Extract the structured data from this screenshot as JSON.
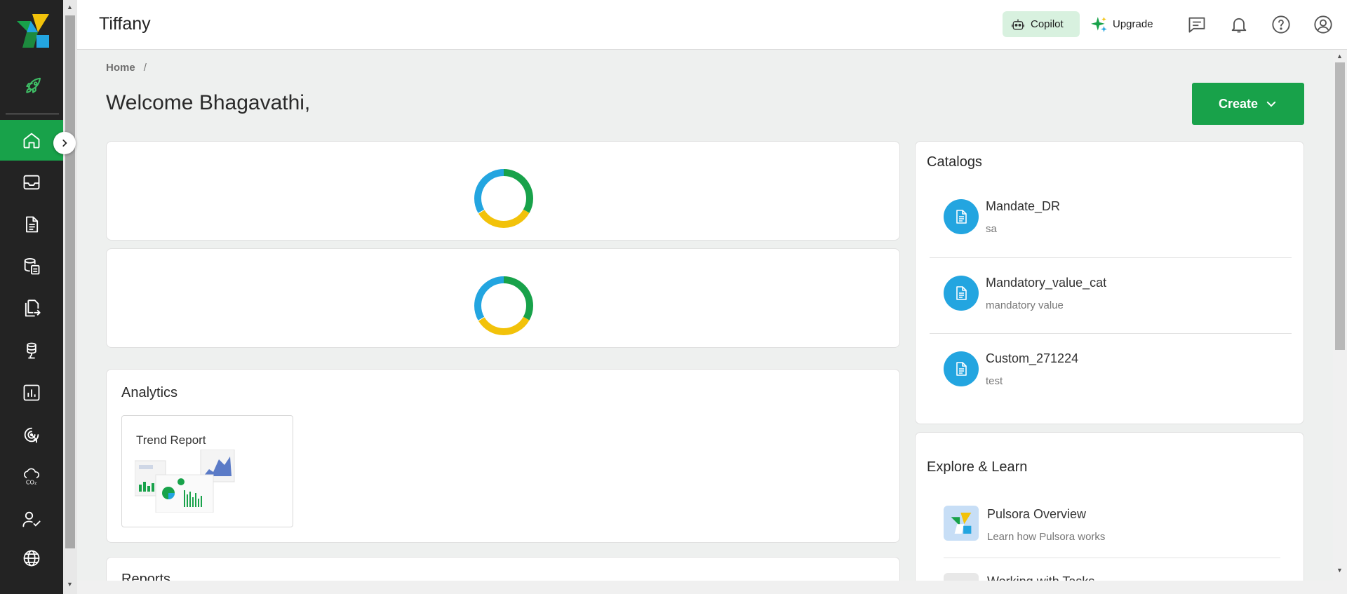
{
  "app": {
    "title": "Tiffany"
  },
  "header": {
    "copilot_label": "Copilot",
    "upgrade_label": "Upgrade",
    "icons": [
      "chat-icon",
      "bell-icon",
      "help-icon",
      "user-account-icon"
    ]
  },
  "sidebar": {
    "items": [
      {
        "icon": "home-icon",
        "active": true
      },
      {
        "icon": "inbox-icon",
        "active": false
      },
      {
        "icon": "document-icon",
        "active": false
      },
      {
        "icon": "data-copy-icon",
        "active": false
      },
      {
        "icon": "export-document-icon",
        "active": false
      },
      {
        "icon": "database-icon",
        "active": false
      },
      {
        "icon": "bar-chart-icon",
        "active": false
      },
      {
        "icon": "target-icon",
        "active": false
      },
      {
        "icon": "co2-cloud-icon",
        "active": false
      },
      {
        "icon": "user-check-icon",
        "active": false
      },
      {
        "icon": "globe-icon",
        "active": false
      }
    ]
  },
  "breadcrumb": {
    "home": "Home",
    "separator": "/"
  },
  "welcome": "Welcome Bhagavathi,",
  "create_button": "Create",
  "analytics": {
    "title": "Analytics",
    "cards": [
      {
        "label": "Trend Report"
      }
    ]
  },
  "reports": {
    "title": "Reports"
  },
  "catalogs": {
    "title": "Catalogs",
    "items": [
      {
        "name": "Mandate_DR",
        "desc": "sa"
      },
      {
        "name": "Mandatory_value_cat",
        "desc": "mandatory value"
      },
      {
        "name": "Custom_271224",
        "desc": "test"
      }
    ]
  },
  "explore": {
    "title": "Explore & Learn",
    "items": [
      {
        "name": "Pulsora Overview",
        "desc": "Learn how Pulsora works"
      },
      {
        "name": "Working with Tasks",
        "desc": ""
      }
    ]
  },
  "colors": {
    "accent": "#18a24a",
    "catalog_avatar": "#23a5e0",
    "sidebar_bg": "#232323"
  }
}
